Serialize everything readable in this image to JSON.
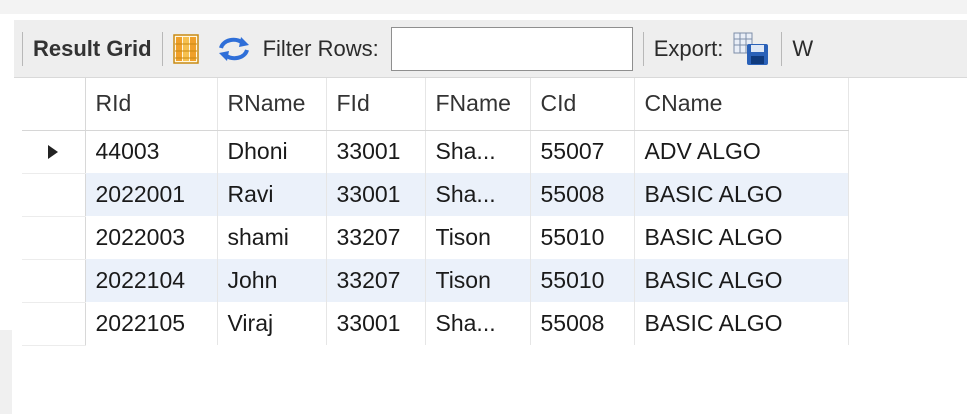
{
  "toolbar": {
    "title": "Result Grid",
    "filter_label": "Filter Rows:",
    "filter_value": "",
    "export_label": "Export:",
    "wrap_label": "W"
  },
  "grid": {
    "columns": [
      "RId",
      "RName",
      "FId",
      "FName",
      "CId",
      "CName"
    ],
    "rows": [
      [
        "44003",
        "Dhoni",
        "33001",
        "Sha...",
        "55007",
        "ADV ALGO"
      ],
      [
        "2022001",
        "Ravi",
        "33001",
        "Sha...",
        "55008",
        "BASIC ALGO"
      ],
      [
        "2022003",
        "shami",
        "33207",
        "Tison",
        "55010",
        "BASIC ALGO"
      ],
      [
        "2022104",
        "John",
        "33207",
        "Tison",
        "55010",
        "BASIC ALGO"
      ],
      [
        "2022105",
        "Viraj",
        "33001",
        "Sha...",
        "55008",
        "BASIC ALGO"
      ]
    ],
    "current_row": 0
  },
  "icons": {
    "form_editor": "grid-layout-icon",
    "refresh": "refresh-arrows-icon",
    "export": "export-save-icon",
    "row_marker": "current-row-arrow-icon"
  },
  "colors": {
    "alt_row": "#ebf1fa",
    "refresh_blue": "#2f6fd8",
    "grid_icon_orange": "#f0a02a"
  }
}
